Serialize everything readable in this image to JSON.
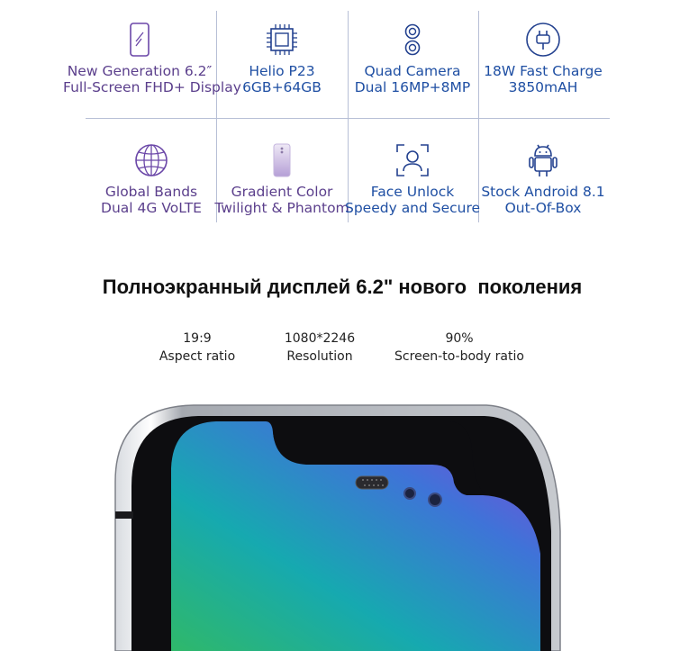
{
  "features": [
    {
      "icon": "smartphone-icon",
      "line1": "New Generation 6.2″",
      "line2": "Full-Screen FHD+ Display"
    },
    {
      "icon": "chip-icon",
      "line1": "Helio P23",
      "line2": "6GB+64GB"
    },
    {
      "icon": "dual-camera-icon",
      "line1": "Quad Camera",
      "line2": "Dual 16MP+8MP"
    },
    {
      "icon": "plug-icon",
      "line1": "18W Fast Charge",
      "line2": "3850mAH"
    },
    {
      "icon": "globe-icon",
      "line1": "Global Bands",
      "line2": "Dual 4G VoLTE"
    },
    {
      "icon": "phone-back-icon",
      "line1": "Gradient Color",
      "line2": "Twilight & Phantom"
    },
    {
      "icon": "face-scan-icon",
      "line1": "Face Unlock",
      "line2": "Speedy and Secure"
    },
    {
      "icon": "android-icon",
      "line1": "Stock Android 8.1",
      "line2": "Out-Of-Box"
    }
  ],
  "headline": "Полноэкранный дисплей 6.2\" нового  поколения",
  "specs": [
    {
      "value": "19:9",
      "label": "Aspect ratio"
    },
    {
      "value": "1080*2246",
      "label": "Resolution"
    },
    {
      "value": "90%",
      "label": "Screen-to-body ratio"
    }
  ],
  "colors": {
    "purple_text": "#5b3f8c",
    "blue_text": "#1f4fa3",
    "divider": "#b7bfd6",
    "icon_purple": "#6b47a8",
    "icon_blue": "#23418f"
  }
}
